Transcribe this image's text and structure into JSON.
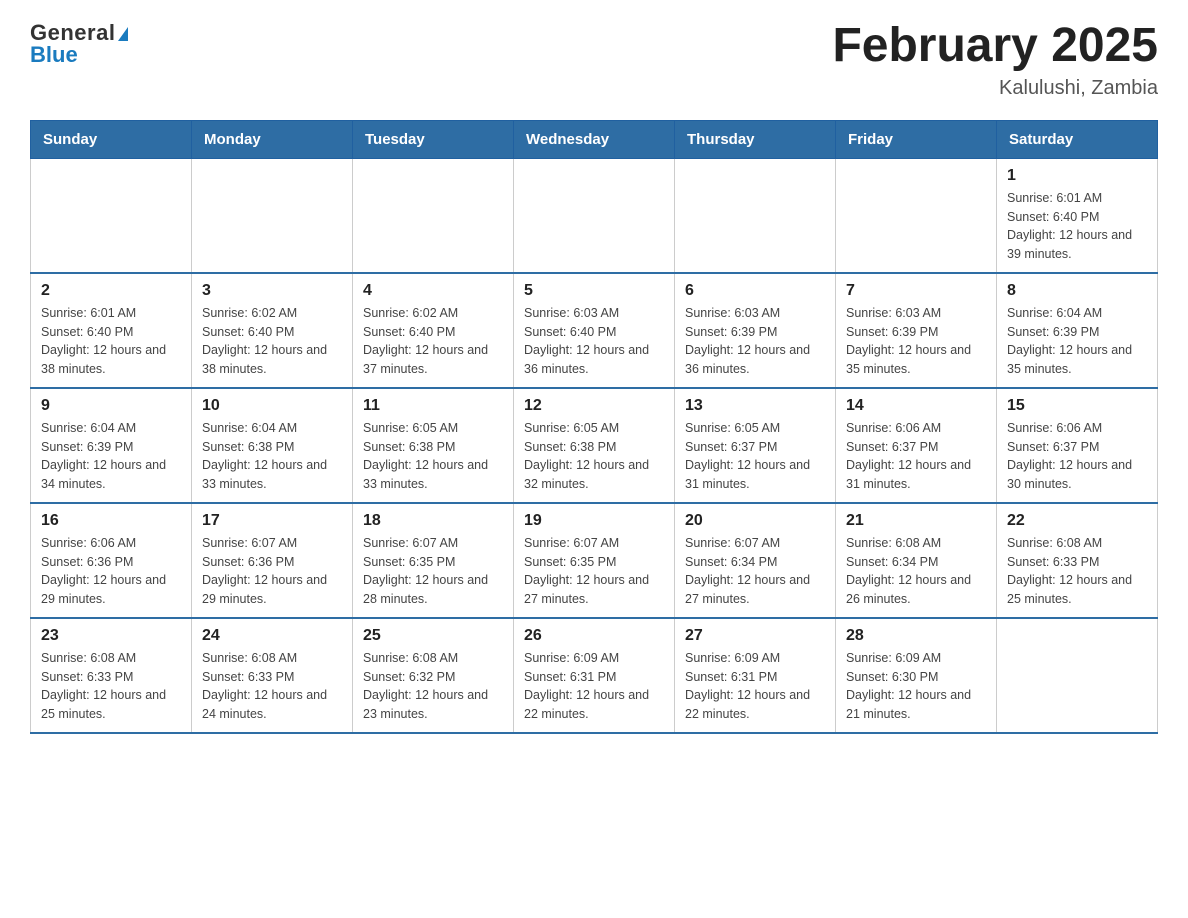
{
  "logo": {
    "general": "General",
    "blue": "Blue",
    "triangle": "▲"
  },
  "header": {
    "title": "February 2025",
    "location": "Kalulushi, Zambia"
  },
  "weekdays": [
    "Sunday",
    "Monday",
    "Tuesday",
    "Wednesday",
    "Thursday",
    "Friday",
    "Saturday"
  ],
  "weeks": [
    [
      {
        "day": "",
        "info": ""
      },
      {
        "day": "",
        "info": ""
      },
      {
        "day": "",
        "info": ""
      },
      {
        "day": "",
        "info": ""
      },
      {
        "day": "",
        "info": ""
      },
      {
        "day": "",
        "info": ""
      },
      {
        "day": "1",
        "info": "Sunrise: 6:01 AM\nSunset: 6:40 PM\nDaylight: 12 hours and 39 minutes."
      }
    ],
    [
      {
        "day": "2",
        "info": "Sunrise: 6:01 AM\nSunset: 6:40 PM\nDaylight: 12 hours and 38 minutes."
      },
      {
        "day": "3",
        "info": "Sunrise: 6:02 AM\nSunset: 6:40 PM\nDaylight: 12 hours and 38 minutes."
      },
      {
        "day": "4",
        "info": "Sunrise: 6:02 AM\nSunset: 6:40 PM\nDaylight: 12 hours and 37 minutes."
      },
      {
        "day": "5",
        "info": "Sunrise: 6:03 AM\nSunset: 6:40 PM\nDaylight: 12 hours and 36 minutes."
      },
      {
        "day": "6",
        "info": "Sunrise: 6:03 AM\nSunset: 6:39 PM\nDaylight: 12 hours and 36 minutes."
      },
      {
        "day": "7",
        "info": "Sunrise: 6:03 AM\nSunset: 6:39 PM\nDaylight: 12 hours and 35 minutes."
      },
      {
        "day": "8",
        "info": "Sunrise: 6:04 AM\nSunset: 6:39 PM\nDaylight: 12 hours and 35 minutes."
      }
    ],
    [
      {
        "day": "9",
        "info": "Sunrise: 6:04 AM\nSunset: 6:39 PM\nDaylight: 12 hours and 34 minutes."
      },
      {
        "day": "10",
        "info": "Sunrise: 6:04 AM\nSunset: 6:38 PM\nDaylight: 12 hours and 33 minutes."
      },
      {
        "day": "11",
        "info": "Sunrise: 6:05 AM\nSunset: 6:38 PM\nDaylight: 12 hours and 33 minutes."
      },
      {
        "day": "12",
        "info": "Sunrise: 6:05 AM\nSunset: 6:38 PM\nDaylight: 12 hours and 32 minutes."
      },
      {
        "day": "13",
        "info": "Sunrise: 6:05 AM\nSunset: 6:37 PM\nDaylight: 12 hours and 31 minutes."
      },
      {
        "day": "14",
        "info": "Sunrise: 6:06 AM\nSunset: 6:37 PM\nDaylight: 12 hours and 31 minutes."
      },
      {
        "day": "15",
        "info": "Sunrise: 6:06 AM\nSunset: 6:37 PM\nDaylight: 12 hours and 30 minutes."
      }
    ],
    [
      {
        "day": "16",
        "info": "Sunrise: 6:06 AM\nSunset: 6:36 PM\nDaylight: 12 hours and 29 minutes."
      },
      {
        "day": "17",
        "info": "Sunrise: 6:07 AM\nSunset: 6:36 PM\nDaylight: 12 hours and 29 minutes."
      },
      {
        "day": "18",
        "info": "Sunrise: 6:07 AM\nSunset: 6:35 PM\nDaylight: 12 hours and 28 minutes."
      },
      {
        "day": "19",
        "info": "Sunrise: 6:07 AM\nSunset: 6:35 PM\nDaylight: 12 hours and 27 minutes."
      },
      {
        "day": "20",
        "info": "Sunrise: 6:07 AM\nSunset: 6:34 PM\nDaylight: 12 hours and 27 minutes."
      },
      {
        "day": "21",
        "info": "Sunrise: 6:08 AM\nSunset: 6:34 PM\nDaylight: 12 hours and 26 minutes."
      },
      {
        "day": "22",
        "info": "Sunrise: 6:08 AM\nSunset: 6:33 PM\nDaylight: 12 hours and 25 minutes."
      }
    ],
    [
      {
        "day": "23",
        "info": "Sunrise: 6:08 AM\nSunset: 6:33 PM\nDaylight: 12 hours and 25 minutes."
      },
      {
        "day": "24",
        "info": "Sunrise: 6:08 AM\nSunset: 6:33 PM\nDaylight: 12 hours and 24 minutes."
      },
      {
        "day": "25",
        "info": "Sunrise: 6:08 AM\nSunset: 6:32 PM\nDaylight: 12 hours and 23 minutes."
      },
      {
        "day": "26",
        "info": "Sunrise: 6:09 AM\nSunset: 6:31 PM\nDaylight: 12 hours and 22 minutes."
      },
      {
        "day": "27",
        "info": "Sunrise: 6:09 AM\nSunset: 6:31 PM\nDaylight: 12 hours and 22 minutes."
      },
      {
        "day": "28",
        "info": "Sunrise: 6:09 AM\nSunset: 6:30 PM\nDaylight: 12 hours and 21 minutes."
      },
      {
        "day": "",
        "info": ""
      }
    ]
  ]
}
